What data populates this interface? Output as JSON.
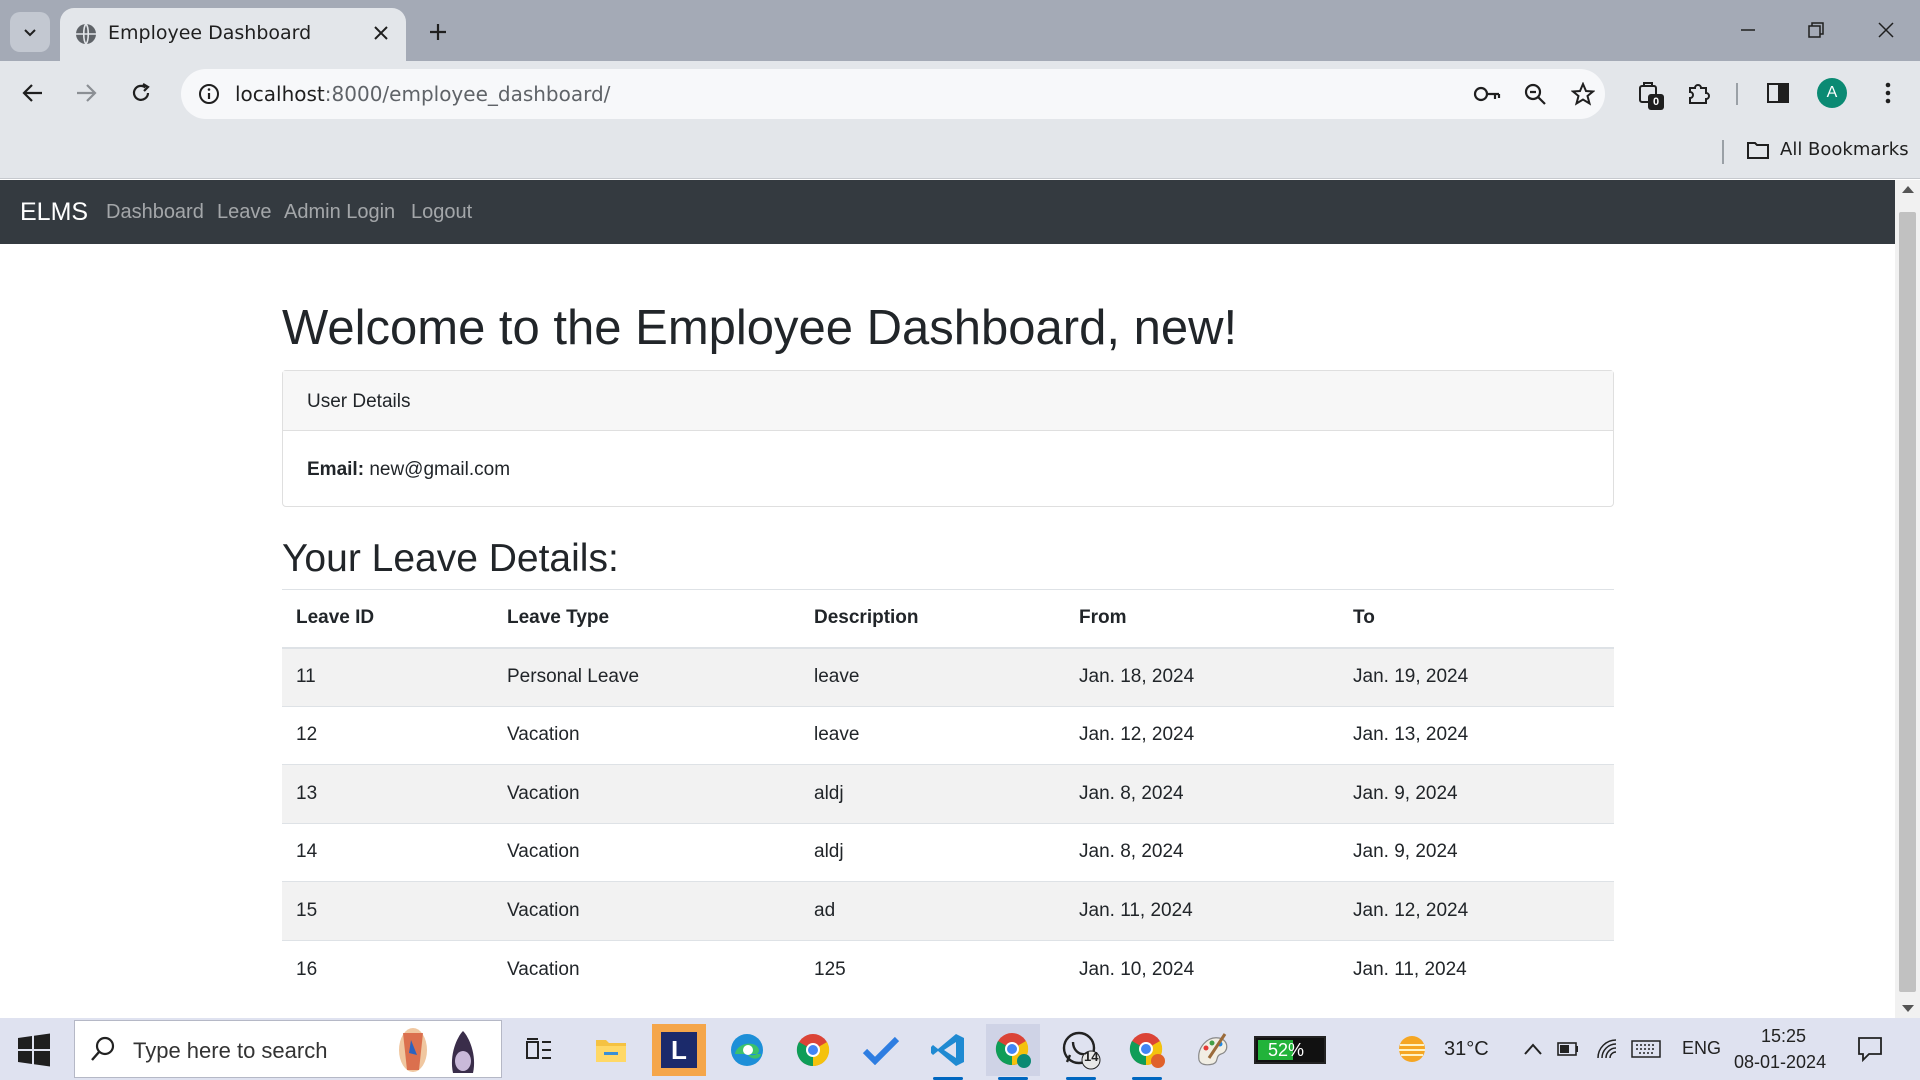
{
  "browser": {
    "tab_title": "Employee Dashboard",
    "url_host": "localhost",
    "url_path": ":8000/employee_dashboard/",
    "extension_badge": "0",
    "profile_initial": "A",
    "bookmarks_label": "All Bookmarks"
  },
  "navbar": {
    "brand": "ELMS",
    "links": [
      "Dashboard",
      "Leave",
      "Admin Login",
      "Logout"
    ]
  },
  "page": {
    "heading": "Welcome to the Employee Dashboard, new!",
    "card_header": "User Details",
    "email_label": "Email:",
    "email_value": "new@gmail.com",
    "leave_heading": "Your Leave Details:"
  },
  "table": {
    "headers": [
      "Leave ID",
      "Leave Type",
      "Description",
      "From",
      "To"
    ],
    "rows": [
      [
        "11",
        "Personal Leave",
        "leave",
        "Jan. 18, 2024",
        "Jan. 19, 2024"
      ],
      [
        "12",
        "Vacation",
        "leave",
        "Jan. 12, 2024",
        "Jan. 13, 2024"
      ],
      [
        "13",
        "Vacation",
        "aldj",
        "Jan. 8, 2024",
        "Jan. 9, 2024"
      ],
      [
        "14",
        "Vacation",
        "aldj",
        "Jan. 8, 2024",
        "Jan. 9, 2024"
      ],
      [
        "15",
        "Vacation",
        "ad",
        "Jan. 11, 2024",
        "Jan. 12, 2024"
      ],
      [
        "16",
        "Vacation",
        "125",
        "Jan. 10, 2024",
        "Jan. 11, 2024"
      ]
    ]
  },
  "taskbar": {
    "search_placeholder": "Type here to search",
    "whatsapp_badge": "14",
    "battery_percent": "52%",
    "weather": "31°C",
    "language": "ENG",
    "time": "15:25",
    "date": "08-01-2024"
  },
  "colors": {
    "navbar_bg": "#343a40",
    "tabstrip_bg": "#a4aab6",
    "toolbar_bg": "#e3e6ea",
    "striped_row": "#f2f2f2"
  },
  "icons": [
    "tab-search-icon",
    "globe-icon",
    "close-icon",
    "plus-icon",
    "minimize-icon",
    "restore-icon",
    "back-icon",
    "forward-icon",
    "reload-icon",
    "info-icon",
    "key-icon",
    "zoom-icon",
    "star-icon",
    "extensions-icon",
    "puzzle-icon",
    "sidebar-icon",
    "menu-icon",
    "folder-icon",
    "windows-icon",
    "search-icon"
  ]
}
